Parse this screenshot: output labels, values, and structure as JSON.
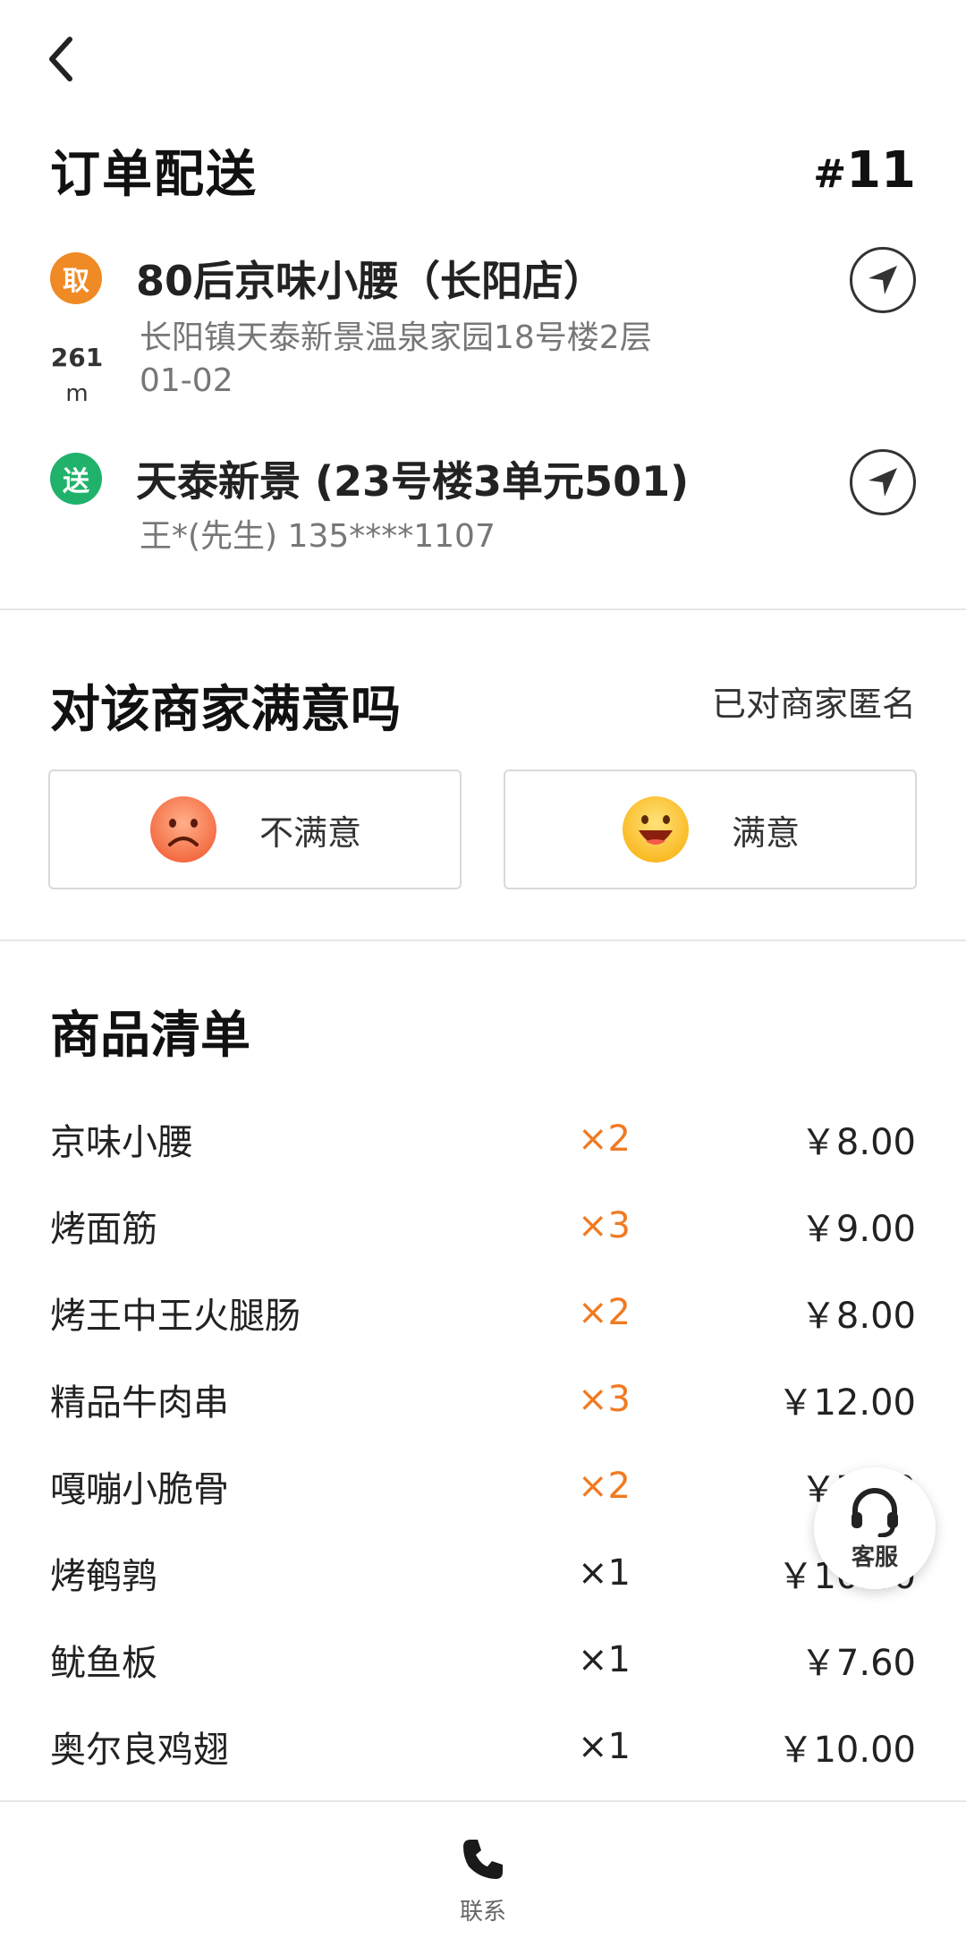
{
  "nav": {
    "back_icon": "chevron-left-icon"
  },
  "order": {
    "title": "订单配送",
    "hash": "#",
    "number": "11"
  },
  "pickup": {
    "badge": "取",
    "name": "80后京味小腰（长阳店）",
    "address_line1": "长阳镇天泰新景温泉家园18号楼2层",
    "address_line2": "01-02",
    "distance_value": "261",
    "distance_unit": "m"
  },
  "delivery": {
    "badge": "送",
    "name": "天泰新景 (23号楼3单元501)",
    "customer": "王*(先生) 135****1107"
  },
  "satisfaction": {
    "title": "对该商家满意吗",
    "anonymous": "已对商家匿名",
    "unsatisfied_label": "不满意",
    "satisfied_label": "满意"
  },
  "products": {
    "title": "商品清单",
    "items": [
      {
        "name": "京味小腰",
        "qty": "×2",
        "price": "￥8.00",
        "highlight": true
      },
      {
        "name": "烤面筋",
        "qty": "×3",
        "price": "￥9.00",
        "highlight": true
      },
      {
        "name": "烤王中王火腿肠",
        "qty": "×2",
        "price": "￥8.00",
        "highlight": true
      },
      {
        "name": "精品牛肉串",
        "qty": "×3",
        "price": "￥12.00",
        "highlight": true
      },
      {
        "name": "嘎嘣小脆骨",
        "qty": "×2",
        "price": "￥7.00",
        "highlight": true
      },
      {
        "name": "烤鹌鹑",
        "qty": "×1",
        "price": "￥10.00",
        "highlight": false
      },
      {
        "name": "鱿鱼板",
        "qty": "×1",
        "price": "￥7.60",
        "highlight": false
      },
      {
        "name": "奥尔良鸡翅",
        "qty": "×1",
        "price": "￥10.00",
        "highlight": false
      }
    ]
  },
  "customer_service": {
    "label": "客服"
  },
  "bottom": {
    "contact_label": "联系"
  },
  "colors": {
    "accent": "#f07a22",
    "pickup_badge": "#f08a24",
    "deliver_badge": "#20b26b"
  }
}
